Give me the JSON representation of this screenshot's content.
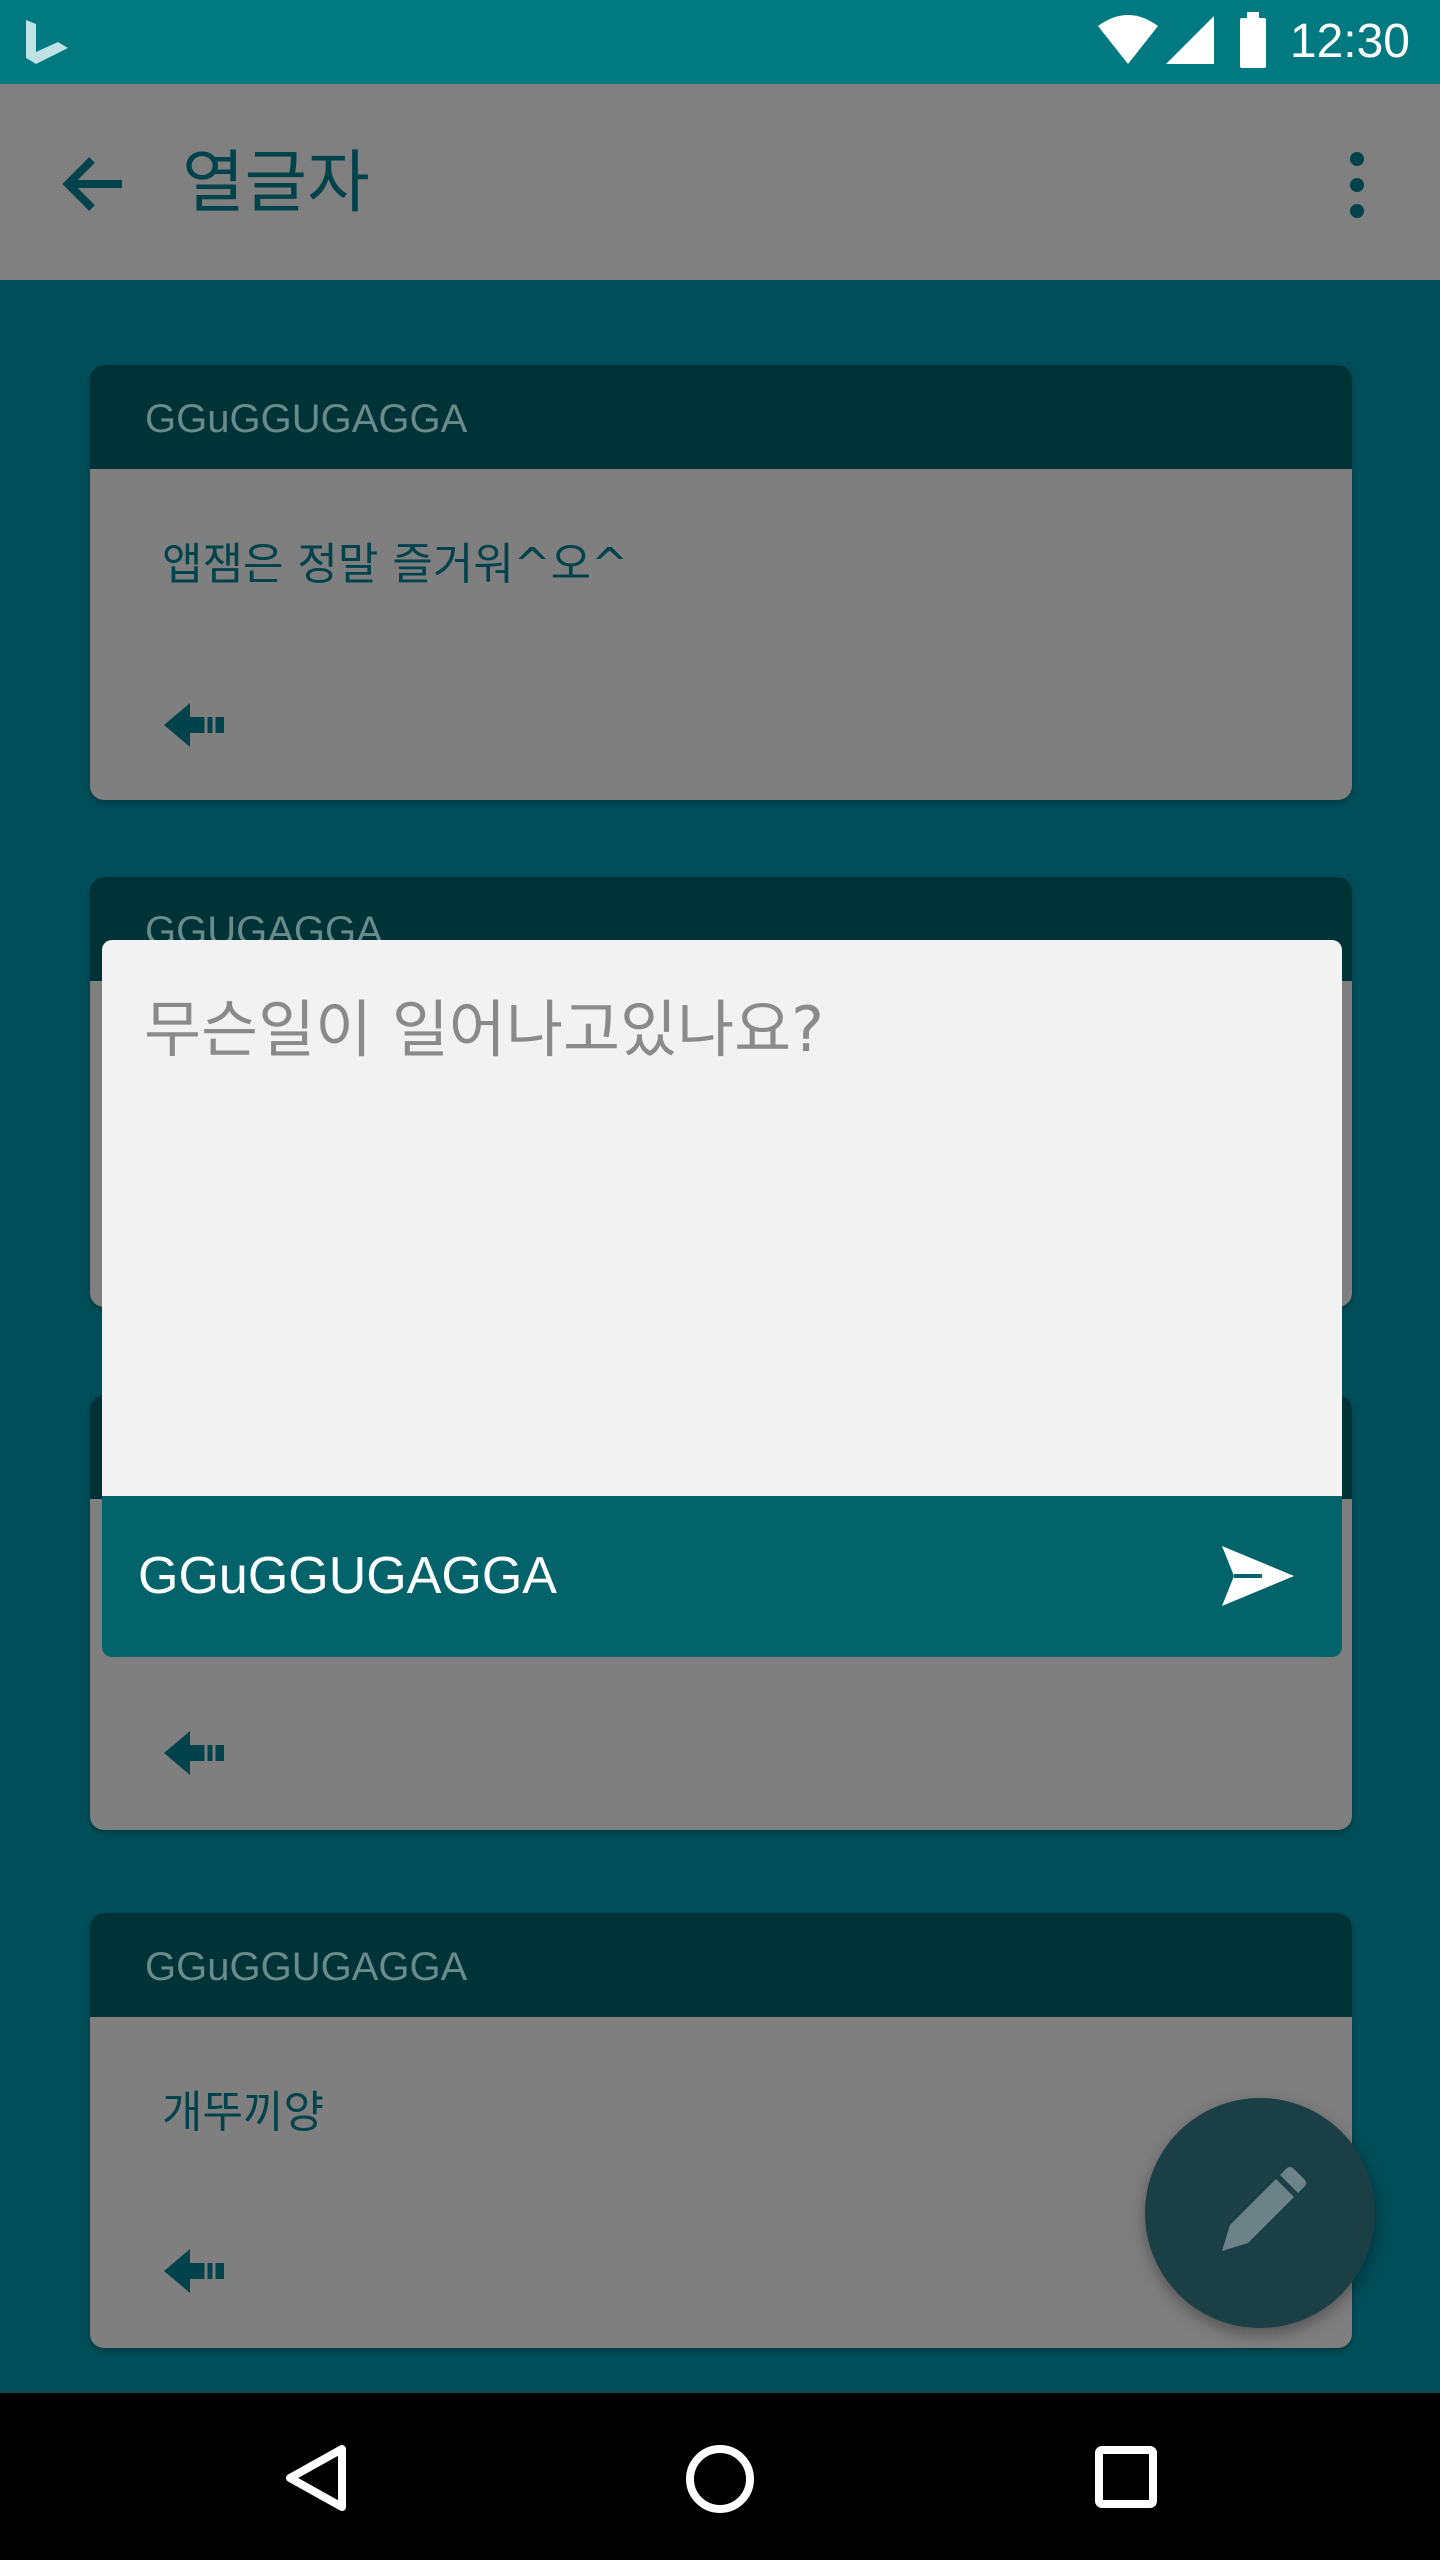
{
  "status_bar": {
    "time": "12:30",
    "icons": [
      "bing-logo-icon",
      "wifi-icon",
      "signal-icon",
      "battery-icon"
    ]
  },
  "toolbar": {
    "title": "열글자",
    "back_icon": "arrow-back-icon",
    "menu_icon": "more-vert-icon"
  },
  "feed": {
    "posts": [
      {
        "author": "GGuGGUGAGGA",
        "text": "앱잼은 정말 즐거워^오^"
      },
      {
        "author": "GGUGAGGA",
        "text": ""
      },
      {
        "author": "",
        "text": ""
      },
      {
        "author": "GGuGGUGAGGA",
        "text": "개뚜끼양"
      }
    ],
    "reply_icon": "reply-icon"
  },
  "compose": {
    "placeholder": "무슨일이 일어나고있나요?",
    "user": "GGuGGUGAGGA",
    "send_icon": "send-icon"
  },
  "fab": {
    "icon": "pencil-icon"
  },
  "nav_bar": {
    "icons": [
      "back-triangle-icon",
      "home-circle-icon",
      "recents-square-icon"
    ]
  },
  "colors": {
    "status_bar": "#007a80",
    "background": "#004e59",
    "card_header": "#003337",
    "compose_footer": "#03636a",
    "fab": "#1a4046"
  }
}
